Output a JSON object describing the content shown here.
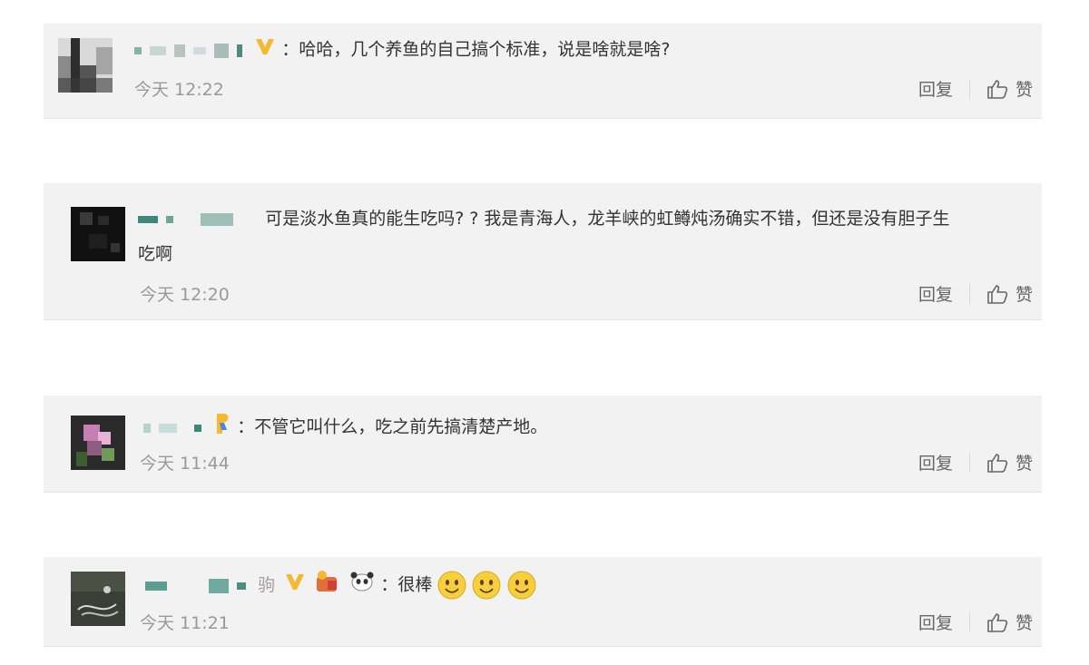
{
  "comments": [
    {
      "text": "：哈哈，几个养鱼的自己搞个标准，说是啥就是啥?",
      "time": "今天 12:22",
      "reply_label": "回复",
      "like_label": "赞",
      "badge_icon": "vip-yellow-v-icon"
    },
    {
      "text": "可是淡水鱼真的能生吃吗? ? 我是青海人，龙羊峡的虹鳟炖汤确实不错，但还是没有胆子生吃啊",
      "time": "今天 12:20",
      "reply_label": "回复",
      "like_label": "赞"
    },
    {
      "text": "：不管它叫什么，吃之前先搞清楚产地。",
      "time": "今天 11:44",
      "reply_label": "回复",
      "like_label": "赞",
      "badge_icon": "level-badge-icon"
    },
    {
      "text": "：很棒",
      "time": "今天 11:21",
      "reply_label": "回复",
      "like_label": "赞",
      "extra_name_char": "驹",
      "emoji_count": 3
    }
  ],
  "colors": {
    "card_bg": "#f2f2f2",
    "time": "#999999",
    "action": "#666666",
    "vip_v": "#f5b82e"
  }
}
